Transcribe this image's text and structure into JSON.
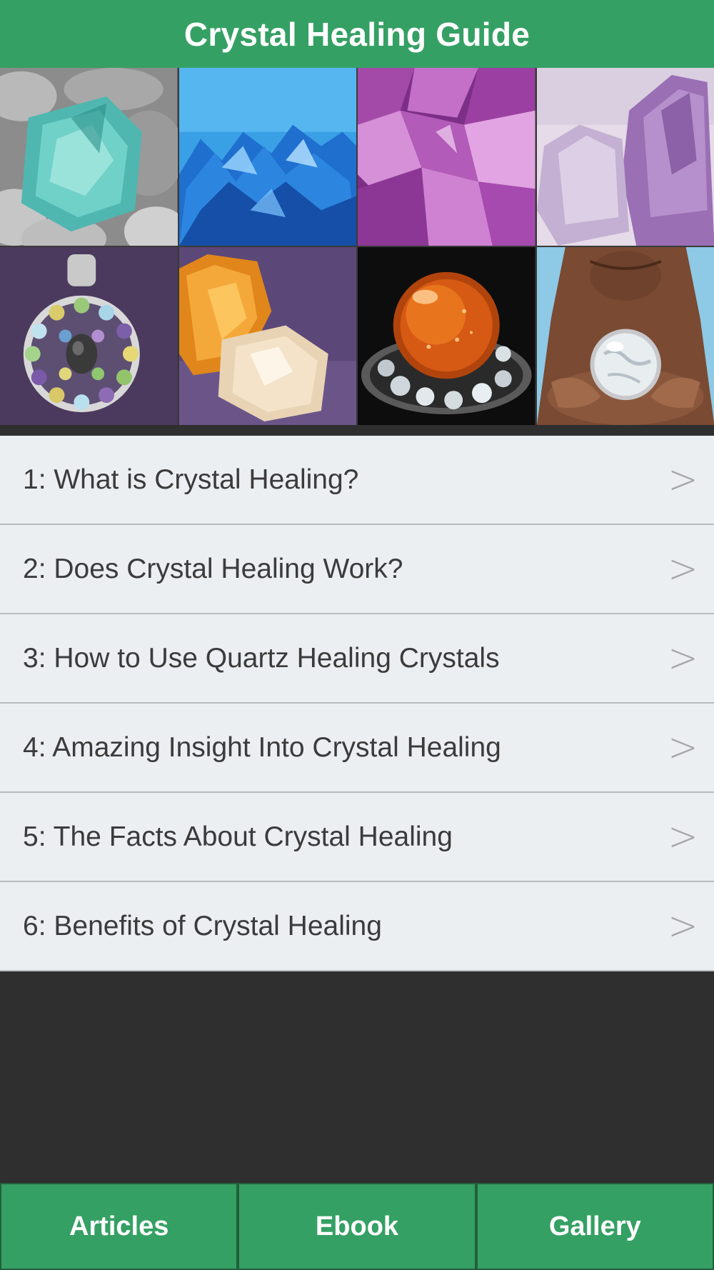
{
  "header": {
    "title": "Crystal Healing Guide",
    "color": "#35a064"
  },
  "gallery": {
    "tiles": [
      {
        "name": "aqua-glass-crystal-on-stones"
      },
      {
        "name": "blue-crystal-cluster"
      },
      {
        "name": "purple-amethyst-geode"
      },
      {
        "name": "lavender-amethyst-points"
      },
      {
        "name": "gemstone-pendant"
      },
      {
        "name": "citrine-and-quartz-stones"
      },
      {
        "name": "amber-crystal-ball"
      },
      {
        "name": "hands-holding-crystal-globe"
      }
    ]
  },
  "menu": {
    "items": [
      {
        "label": "1: What is Crystal Healing?"
      },
      {
        "label": "2: Does Crystal Healing Work?"
      },
      {
        "label": "3: How to Use Quartz Healing Crystals"
      },
      {
        "label": "4: Amazing Insight Into Crystal Healing"
      },
      {
        "label": "5: The Facts About Crystal Healing"
      },
      {
        "label": "6: Benefits of Crystal Healing"
      }
    ],
    "chevron": ">"
  },
  "tabbar": {
    "tabs": [
      {
        "label": "Articles"
      },
      {
        "label": "Ebook"
      },
      {
        "label": "Gallery"
      }
    ]
  }
}
